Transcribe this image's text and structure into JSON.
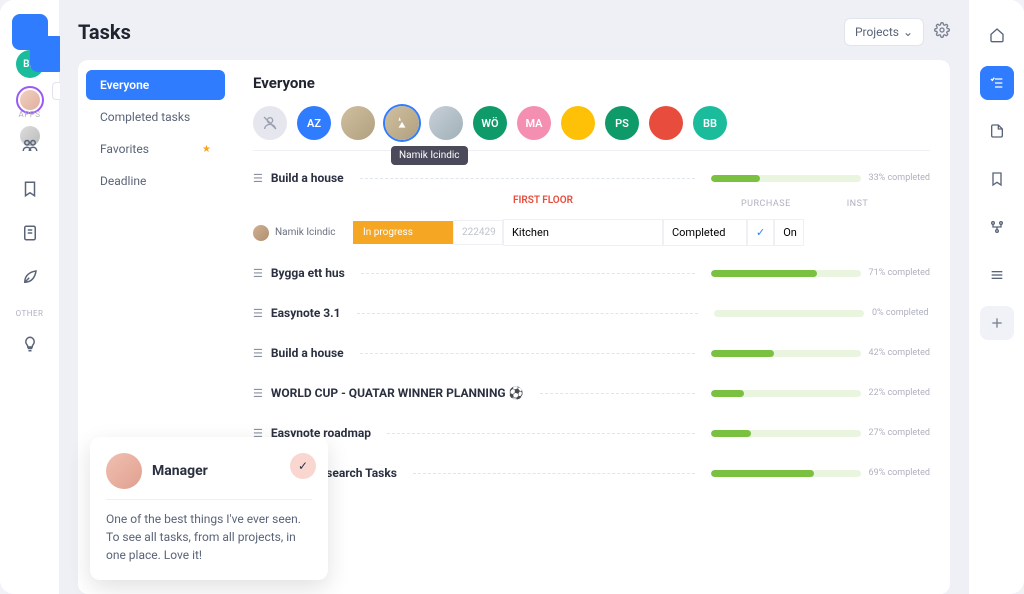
{
  "page": {
    "title": "Tasks"
  },
  "toolbar": {
    "dropdown_label": "Projects"
  },
  "left_rail": {
    "bb_label": "BB",
    "section_apps": "APPS",
    "section_other": "OTHER"
  },
  "filters": {
    "items": [
      {
        "label": "Everyone"
      },
      {
        "label": "Completed tasks"
      },
      {
        "label": "Favorites"
      },
      {
        "label": "Deadline"
      }
    ]
  },
  "main": {
    "section_title": "Everyone",
    "tooltip_name": "Namik Icindic",
    "people": [
      {
        "label": "",
        "bg": "#e6e6ee",
        "fg": "#8a90a0",
        "icon": true
      },
      {
        "label": "AZ",
        "bg": "#2f7cff"
      },
      {
        "label": "",
        "bg": "img"
      },
      {
        "label": "",
        "bg": "img",
        "ring": true
      },
      {
        "label": "",
        "bg": "img"
      },
      {
        "label": "WÖ",
        "bg": "#0f9a6a"
      },
      {
        "label": "MA",
        "bg": "#f48fb1"
      },
      {
        "label": "",
        "bg": "#ffc107",
        "img": true
      },
      {
        "label": "PS",
        "bg": "#0f9a6a"
      },
      {
        "label": "",
        "bg": "#e74c3c",
        "img": true
      },
      {
        "label": "BB",
        "bg": "#1abc9c"
      }
    ],
    "tasks": [
      {
        "name": "Build a house",
        "pct": "33% completed",
        "fill": 33
      },
      {
        "name": "Bygga ett hus",
        "pct": "71% completed",
        "fill": 71
      },
      {
        "name": "Easynote 3.1",
        "pct": "0% completed",
        "fill": 0
      },
      {
        "name": "Build a house",
        "pct": "42% completed",
        "fill": 42
      },
      {
        "name": "WORLD CUP - QUATAR WINNER PLANNING ⚽",
        "pct": "22% completed",
        "fill": 22
      },
      {
        "name": "Easynote roadmap",
        "pct": "27% completed",
        "fill": 27
      },
      {
        "name": "Market Research Tasks",
        "pct": "69% completed",
        "fill": 69
      }
    ],
    "detail_row": {
      "assignee": "Namik Icindic",
      "status": "In progress",
      "code": "222429",
      "col_first": "FIRST FLOOR",
      "col_purchase": "PURCHASE",
      "col_inst": "INST",
      "field1": "Kitchen",
      "field2": "Completed",
      "field3": "On"
    }
  },
  "popup": {
    "role": "Manager",
    "text": "One of the best things I've ever seen. To see all tasks, from all projects, in one place. Love it!"
  }
}
